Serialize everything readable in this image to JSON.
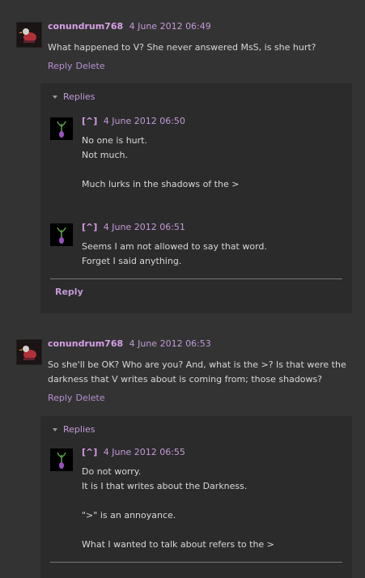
{
  "comments": [
    {
      "author": "conundrum768",
      "timestamp": "4 June 2012 06:49",
      "body": "What happened to V? She never answered MsS, is she hurt?",
      "actions": [
        "Reply",
        "Delete"
      ],
      "thread": {
        "toggle": "Replies",
        "replies": [
          {
            "author": "[^]",
            "timestamp": "4 June 2012 06:50",
            "lines": [
              "No one is hurt.",
              "Not much.",
              "",
              "Much lurks in the shadows of the >"
            ]
          },
          {
            "author": "[^]",
            "timestamp": "4 June 2012 06:51",
            "lines": [
              "Seems I am not allowed to say that word.",
              "Forget I said anything."
            ]
          }
        ],
        "reply_button": "Reply"
      }
    },
    {
      "author": "conundrum768",
      "timestamp": "4 June 2012 06:53",
      "body": "So she'll be OK? Who are you? And, what is the >? Is that were the darkness that V writes about is coming from; those shadows?",
      "actions": [
        "Reply",
        "Delete"
      ],
      "thread": {
        "toggle": "Replies",
        "replies": [
          {
            "author": "[^]",
            "timestamp": "4 June 2012 06:55",
            "lines": [
              "Do not worry.",
              "It is I that writes about the Darkness.",
              "",
              "\">\" is an annoyance.",
              "",
              "What I wanted to talk about refers to the >"
            ]
          }
        ]
      }
    }
  ],
  "icons": {
    "main_avatar": "duck-avatar-icon",
    "reply_avatar": "plant-sprout-icon"
  }
}
